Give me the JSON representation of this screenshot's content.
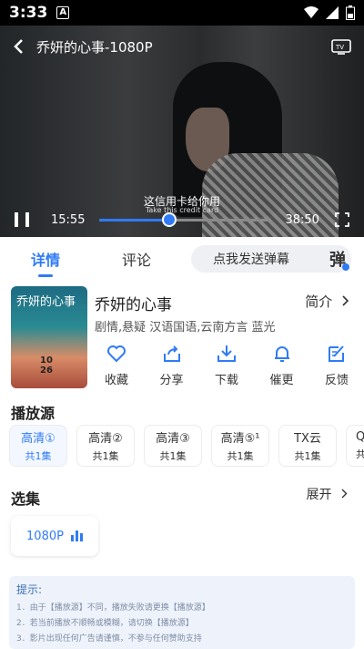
{
  "status": {
    "time": "3:33",
    "badge": "A"
  },
  "player": {
    "title": "乔妍的心事-1080P",
    "subtitle": "这信用卡给你用",
    "subtitle_en": "Take this credit card",
    "current_time": "15:55",
    "duration": "38:50",
    "progress": 0.41
  },
  "tabs": {
    "details": "详情",
    "comments": "评论",
    "danmu_placeholder": "点我发送弹幕",
    "danmu_toggle": "弹"
  },
  "show": {
    "name": "乔妍的心事",
    "intro_label": "简介",
    "tags": "剧情,悬疑 汉语国语,云南方言 蓝光",
    "poster_title": "乔妍的心事",
    "poster_date": "10\n26"
  },
  "actions": [
    {
      "label": "收藏",
      "icon": "heart-icon"
    },
    {
      "label": "分享",
      "icon": "share-icon"
    },
    {
      "label": "下载",
      "icon": "download-icon"
    },
    {
      "label": "催更",
      "icon": "bell-icon"
    },
    {
      "label": "反馈",
      "icon": "feedback-icon"
    }
  ],
  "sources_title": "播放源",
  "sources": [
    {
      "name": "高清①",
      "count": "共1集"
    },
    {
      "name": "高清②",
      "count": "共1集"
    },
    {
      "name": "高清③",
      "count": "共1集"
    },
    {
      "name": "高清⑤¹",
      "count": "共1集"
    },
    {
      "name": "TX云",
      "count": "共1集"
    },
    {
      "name": "Q",
      "count": "共"
    }
  ],
  "episodes_title": "选集",
  "expand_label": "展开",
  "episode": {
    "label": "1080P"
  },
  "tips": {
    "header": "提示:",
    "lines": [
      "1．由于【播放源】不同，播放失败请更换【播放源】",
      "2．若当前播放不顺畅或模糊，请切换【播放源】",
      "3．影片出现任何广告请谨慎，不参与任何赞助支持"
    ]
  },
  "colors": {
    "accent": "#2f7bf6"
  }
}
